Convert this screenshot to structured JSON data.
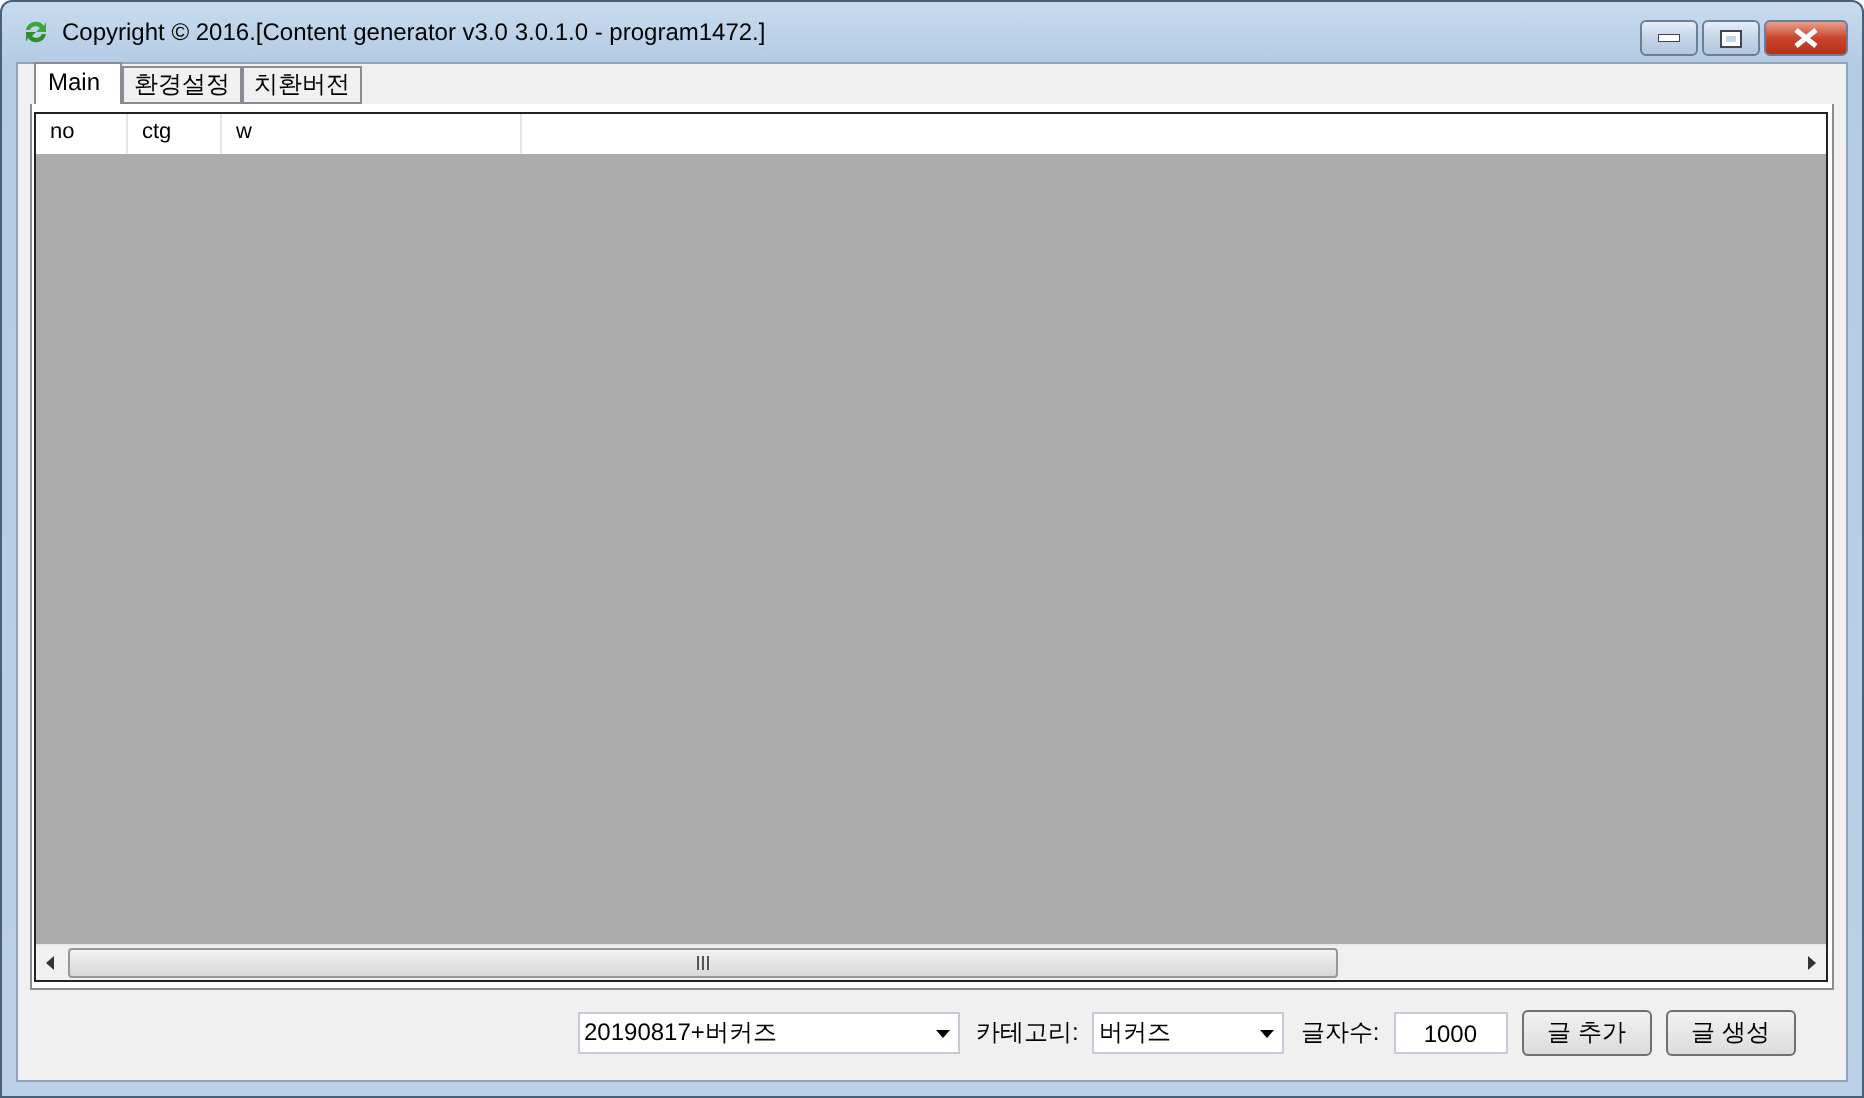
{
  "window": {
    "title": "Copyright © 2016.[Content generator v3.0 3.0.1.0 - program1472.]"
  },
  "tabs": [
    {
      "label": "Main",
      "selected": true
    },
    {
      "label": "환경설정",
      "selected": false
    },
    {
      "label": "치환버전",
      "selected": false
    }
  ],
  "table": {
    "columns": [
      "no",
      "ctg",
      "w"
    ]
  },
  "controls": {
    "preset": {
      "value": "20190817+버커즈"
    },
    "category_label": "카테고리:",
    "category": {
      "value": "버커즈"
    },
    "count_label": "글자수:",
    "count": {
      "value": "1000"
    },
    "buttons": [
      "글 추가",
      "글 생성"
    ]
  }
}
